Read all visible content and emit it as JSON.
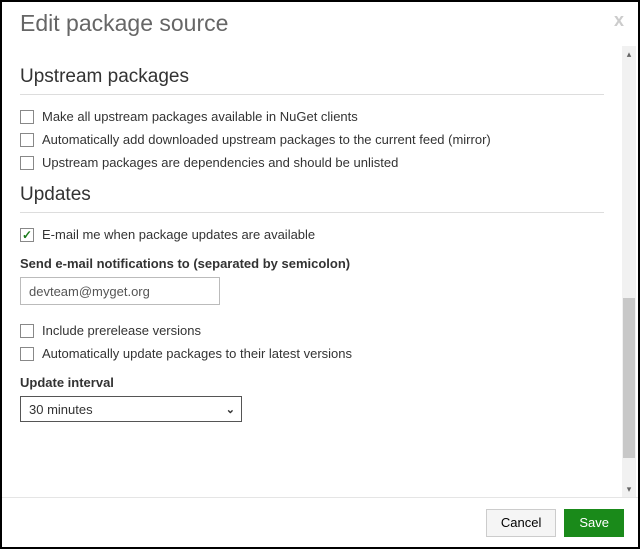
{
  "dialog": {
    "title": "Edit package source",
    "close_icon": "x"
  },
  "upstream": {
    "heading": "Upstream packages",
    "opt_make_available": {
      "label": "Make all upstream packages available in NuGet clients",
      "checked": false
    },
    "opt_auto_add": {
      "label": "Automatically add downloaded upstream packages to the current feed (mirror)",
      "checked": false
    },
    "opt_deps_unlisted": {
      "label": "Upstream packages are dependencies and should be unlisted",
      "checked": false
    }
  },
  "updates": {
    "heading": "Updates",
    "opt_email": {
      "label": "E-mail me when package updates are available",
      "checked": true
    },
    "email_field_label": "Send e-mail notifications to (separated by semicolon)",
    "email_value": "devteam@myget.org",
    "opt_prerelease": {
      "label": "Include prerelease versions",
      "checked": false
    },
    "opt_auto_update": {
      "label": "Automatically update packages to their latest versions",
      "checked": false
    },
    "interval_label": "Update interval",
    "interval_value": "30 minutes"
  },
  "footer": {
    "cancel": "Cancel",
    "save": "Save"
  }
}
